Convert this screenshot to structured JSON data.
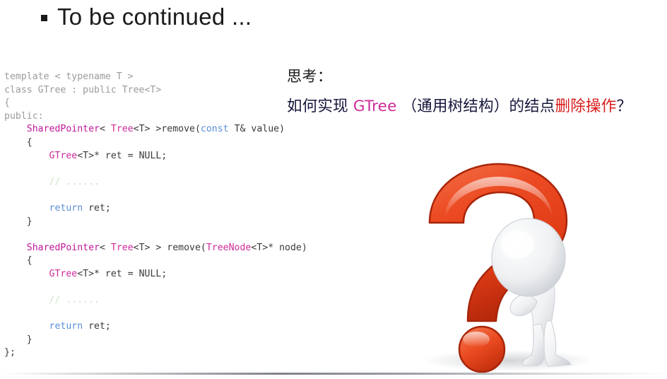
{
  "slide": {
    "title": "To be continued ...",
    "bullet_glyph": "square-bullet"
  },
  "code": {
    "language": "cpp",
    "lines": [
      [
        {
          "t": "template < typename T >",
          "c": "dim"
        }
      ],
      [
        {
          "t": "class GTree : public Tree<T>",
          "c": "dim"
        }
      ],
      [
        {
          "t": "{",
          "c": "dim"
        }
      ],
      [
        {
          "t": "public:",
          "c": "dim"
        }
      ],
      [
        {
          "t": "    ",
          "c": "plain"
        },
        {
          "t": "SharedPointer",
          "c": "type"
        },
        {
          "t": "< ",
          "c": "plain"
        },
        {
          "t": "Tree",
          "c": "type2"
        },
        {
          "t": "<T> >remove(",
          "c": "plain"
        },
        {
          "t": "const",
          "c": "kw"
        },
        {
          "t": " T& value)",
          "c": "plain"
        }
      ],
      [
        {
          "t": "    {",
          "c": "plain"
        }
      ],
      [
        {
          "t": "        ",
          "c": "plain"
        },
        {
          "t": "GTree",
          "c": "type2"
        },
        {
          "t": "<T>* ret = NULL;",
          "c": "plain"
        }
      ],
      [
        {
          "t": "",
          "c": "plain"
        }
      ],
      [
        {
          "t": "        ",
          "c": "plain"
        },
        {
          "t": "// ......",
          "c": "comment"
        }
      ],
      [
        {
          "t": "",
          "c": "plain"
        }
      ],
      [
        {
          "t": "        ",
          "c": "plain"
        },
        {
          "t": "return",
          "c": "kw"
        },
        {
          "t": " ret;",
          "c": "plain"
        }
      ],
      [
        {
          "t": "    }",
          "c": "plain"
        }
      ],
      [
        {
          "t": "",
          "c": "plain"
        }
      ],
      [
        {
          "t": "    ",
          "c": "plain"
        },
        {
          "t": "SharedPointer",
          "c": "type"
        },
        {
          "t": "< ",
          "c": "plain"
        },
        {
          "t": "Tree",
          "c": "type2"
        },
        {
          "t": "<T> > remove(",
          "c": "plain"
        },
        {
          "t": "TreeNode",
          "c": "type2"
        },
        {
          "t": "<T>* node)",
          "c": "plain"
        }
      ],
      [
        {
          "t": "    {",
          "c": "plain"
        }
      ],
      [
        {
          "t": "        ",
          "c": "plain"
        },
        {
          "t": "GTree",
          "c": "type2"
        },
        {
          "t": "<T>* ret = NULL;",
          "c": "plain"
        }
      ],
      [
        {
          "t": "",
          "c": "plain"
        }
      ],
      [
        {
          "t": "        ",
          "c": "plain"
        },
        {
          "t": "// ......",
          "c": "comment"
        }
      ],
      [
        {
          "t": "",
          "c": "plain"
        }
      ],
      [
        {
          "t": "        ",
          "c": "plain"
        },
        {
          "t": "return",
          "c": "kw"
        },
        {
          "t": " ret;",
          "c": "plain"
        }
      ],
      [
        {
          "t": "    }",
          "c": "plain"
        }
      ],
      [
        {
          "t": "};",
          "c": "plain"
        }
      ]
    ]
  },
  "notes": {
    "think_label": "思考：",
    "question": {
      "part1": "如何实现 ",
      "accent": "GTree",
      "part2": " （通用树结构）的结点",
      "red": "删除操作",
      "part3": "？"
    }
  },
  "artwork": {
    "name": "question-mark-thinking-figure",
    "description": "3D glossy red question mark with white 3D human figure in thinking pose"
  },
  "colors": {
    "title": "#1a1a1a",
    "code_dim": "#9b9b9b",
    "code_plain": "#3a3a3a",
    "code_type": "#c0179b",
    "code_keyword": "#5a8fd6",
    "code_comment": "#cfe0c8",
    "question_text": "#16163c",
    "question_accent": "#cf2b9a",
    "question_red": "#d81b1b",
    "qmark_red": "#e8401a"
  }
}
